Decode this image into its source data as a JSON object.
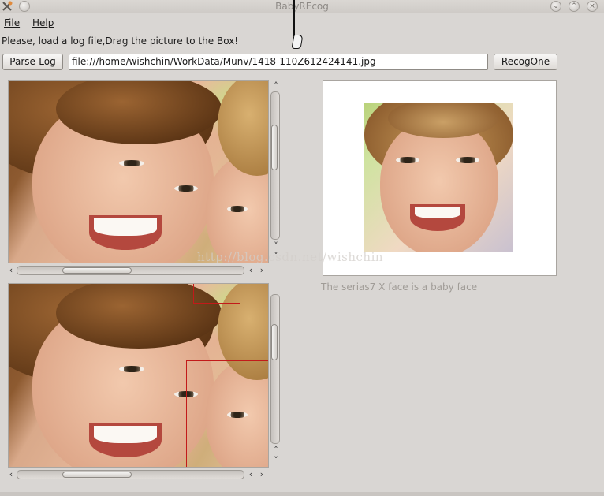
{
  "window": {
    "title": "BabyREcog"
  },
  "menu": {
    "file": "File",
    "help": "Help"
  },
  "prompt": "Please, load a log file,Drag the picture to the Box!",
  "toolbar": {
    "parse_log_label": "Parse-Log",
    "path_value": "file:///home/wishchin/WorkData/Munv/1418-110Z612424141.jpg",
    "recog_label": "RecogOne"
  },
  "scroll_glyphs": {
    "up": "˄",
    "down": "˅",
    "left": "‹",
    "right": "›"
  },
  "result_text": "The serias7 X face is a baby face",
  "watermark": "http://blog.csdn.net/wishchin",
  "colors": {
    "window_bg": "#d9d6d3",
    "detection_box": "#c21a1a"
  },
  "icons": {
    "close_app": "x-tools-icon",
    "menu_small": "circle-icon",
    "minimize": "chevron-down-icon",
    "maximize": "chevron-up-icon",
    "close": "close-icon"
  }
}
